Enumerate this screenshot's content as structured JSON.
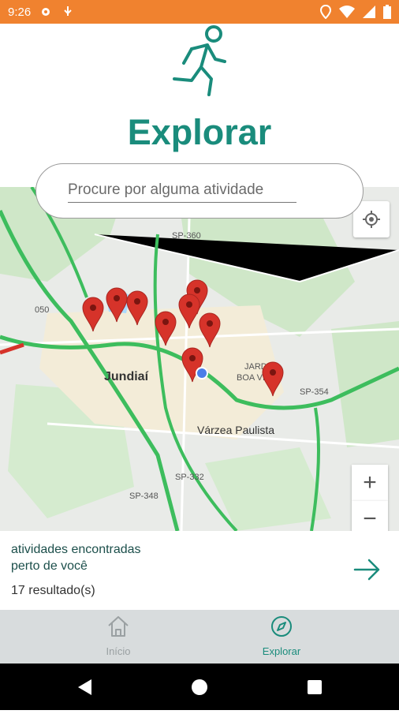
{
  "status_bar": {
    "time": "9:26",
    "icons": [
      "settings-icon",
      "usb-icon",
      "location-icon",
      "wifi-icon",
      "signal-icon",
      "battery-icon"
    ]
  },
  "page": {
    "title": "Explorar",
    "hero_icon": "running-person-icon"
  },
  "search": {
    "placeholder": "Procure por alguma atividade",
    "value": ""
  },
  "map": {
    "road_labels": [
      "SP-360",
      "050",
      "SP-354",
      "SP-332",
      "SP-348"
    ],
    "place_labels": [
      "Jundiaí",
      "JARDIM",
      "BOA VISTA",
      "Várzea Paulista"
    ],
    "zoom_in": "+",
    "zoom_out": "−",
    "marker_count": 10,
    "colors": {
      "water": "#aadaff",
      "green": "#cde8c9",
      "urban": "#f4ead0",
      "traffic": "#3dbd5d",
      "marker": "#d6332a"
    }
  },
  "results": {
    "line1": "atividades encontradas",
    "line2": "perto de você",
    "count": "17 resultado(s)"
  },
  "bottom_nav": {
    "items": [
      {
        "label": "Início",
        "icon": "home-icon",
        "active": false
      },
      {
        "label": "Explorar",
        "icon": "compass-icon",
        "active": true
      }
    ]
  },
  "accent_color": "#1a8c7c",
  "status_color": "#f0822f"
}
